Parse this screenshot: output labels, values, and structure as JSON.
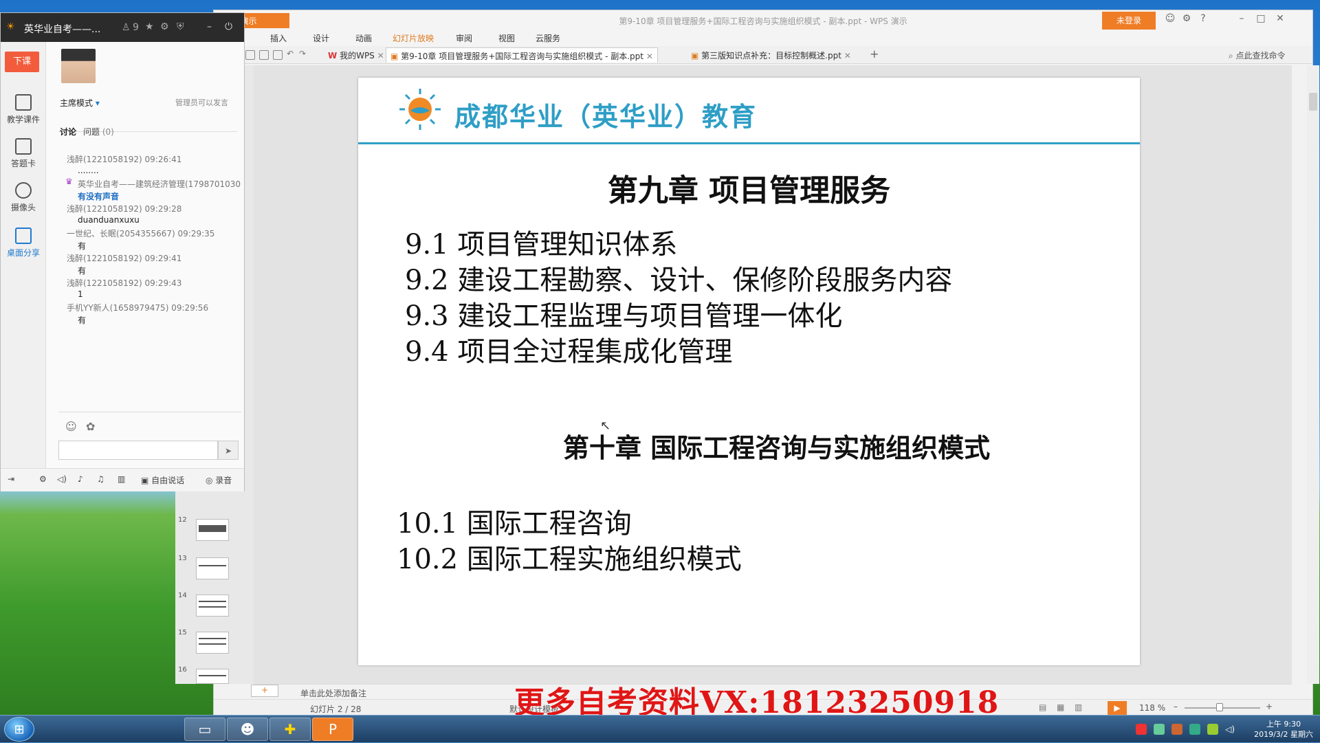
{
  "wps": {
    "app_tab": "WPS 演示",
    "title": "第9-10章 项目管理服务+国际工程咨询与实施组织模式 - 副本.ppt - WPS 演示",
    "login": "未登录",
    "menu": [
      "插入",
      "设计",
      "动画",
      "幻灯片放映",
      "审阅",
      "视图",
      "云服务"
    ],
    "active_menu": "幻灯片放映",
    "tabs": [
      "我的WPS",
      "第9-10章 项目管理服务+国际工程咨询与实施组织模式 - 副本.ppt",
      "第三版知识点补充：目标控制概述.ppt"
    ],
    "search_label": "点此查找命令",
    "thumb_numbers": [
      "12",
      "13",
      "14",
      "15",
      "16"
    ],
    "notes_placeholder": "单击此处添加备注",
    "slide_counter": "幻灯片 2 / 28",
    "template_label": "默认设计模板",
    "zoom": "118 %"
  },
  "slide": {
    "brand": "成都华业（英华业）教育",
    "chapter9_title": "第九章 项目管理服务",
    "chapter9_sections": [
      "9.1  项目管理知识体系",
      "9.2  建设工程勘察、设计、保修阶段服务内容",
      "9.3  建设工程监理与项目管理一体化",
      "9.4  项目全过程集成化管理"
    ],
    "chapter10_title": "第十章 国际工程咨询与实施组织模式",
    "chapter10_sections": [
      "10.1  国际工程咨询",
      "10.2  国际工程实施组织模式"
    ]
  },
  "watermark": "更多自考资料VX:18123250918",
  "yy": {
    "title": "英华业自考——...",
    "member_count": "9",
    "end_class": "下课",
    "sidebar": [
      "教学课件",
      "答题卡",
      "摄像头",
      "桌面分享"
    ],
    "mode": "主席模式",
    "admin_note": "管理员可以发言",
    "tab_discuss": "讨论",
    "tab_question": "问题",
    "question_count": "(0)",
    "chat": [
      {
        "meta": "浅醉(1221058192) 09:26:41",
        "msg": "........"
      },
      {
        "meta": "英华业自考——建筑经济管理(1798701030",
        "msg": "有没有声音"
      },
      {
        "meta": "浅醉(1221058192) 09:29:28",
        "msg": "duanduanxuxu"
      },
      {
        "meta": "一世纪、长眠(2054355667) 09:29:35",
        "msg": "有"
      },
      {
        "meta": "浅醉(1221058192) 09:29:41",
        "msg": "有"
      },
      {
        "meta": "浅醉(1221058192) 09:29:43",
        "msg": "1"
      },
      {
        "meta": "手机YY新人(1658979475) 09:29:56",
        "msg": "有"
      }
    ],
    "free_talk": "自由说话",
    "record": "录音"
  },
  "taskbar": {
    "time": "上午 9:30",
    "date": "2019/3/2 星期六"
  },
  "colors": {
    "wps_orange": "#ef7d26",
    "brand_blue": "#2e9ec6",
    "watermark_red": "#e01616",
    "end_class_red": "#f25c3c"
  }
}
